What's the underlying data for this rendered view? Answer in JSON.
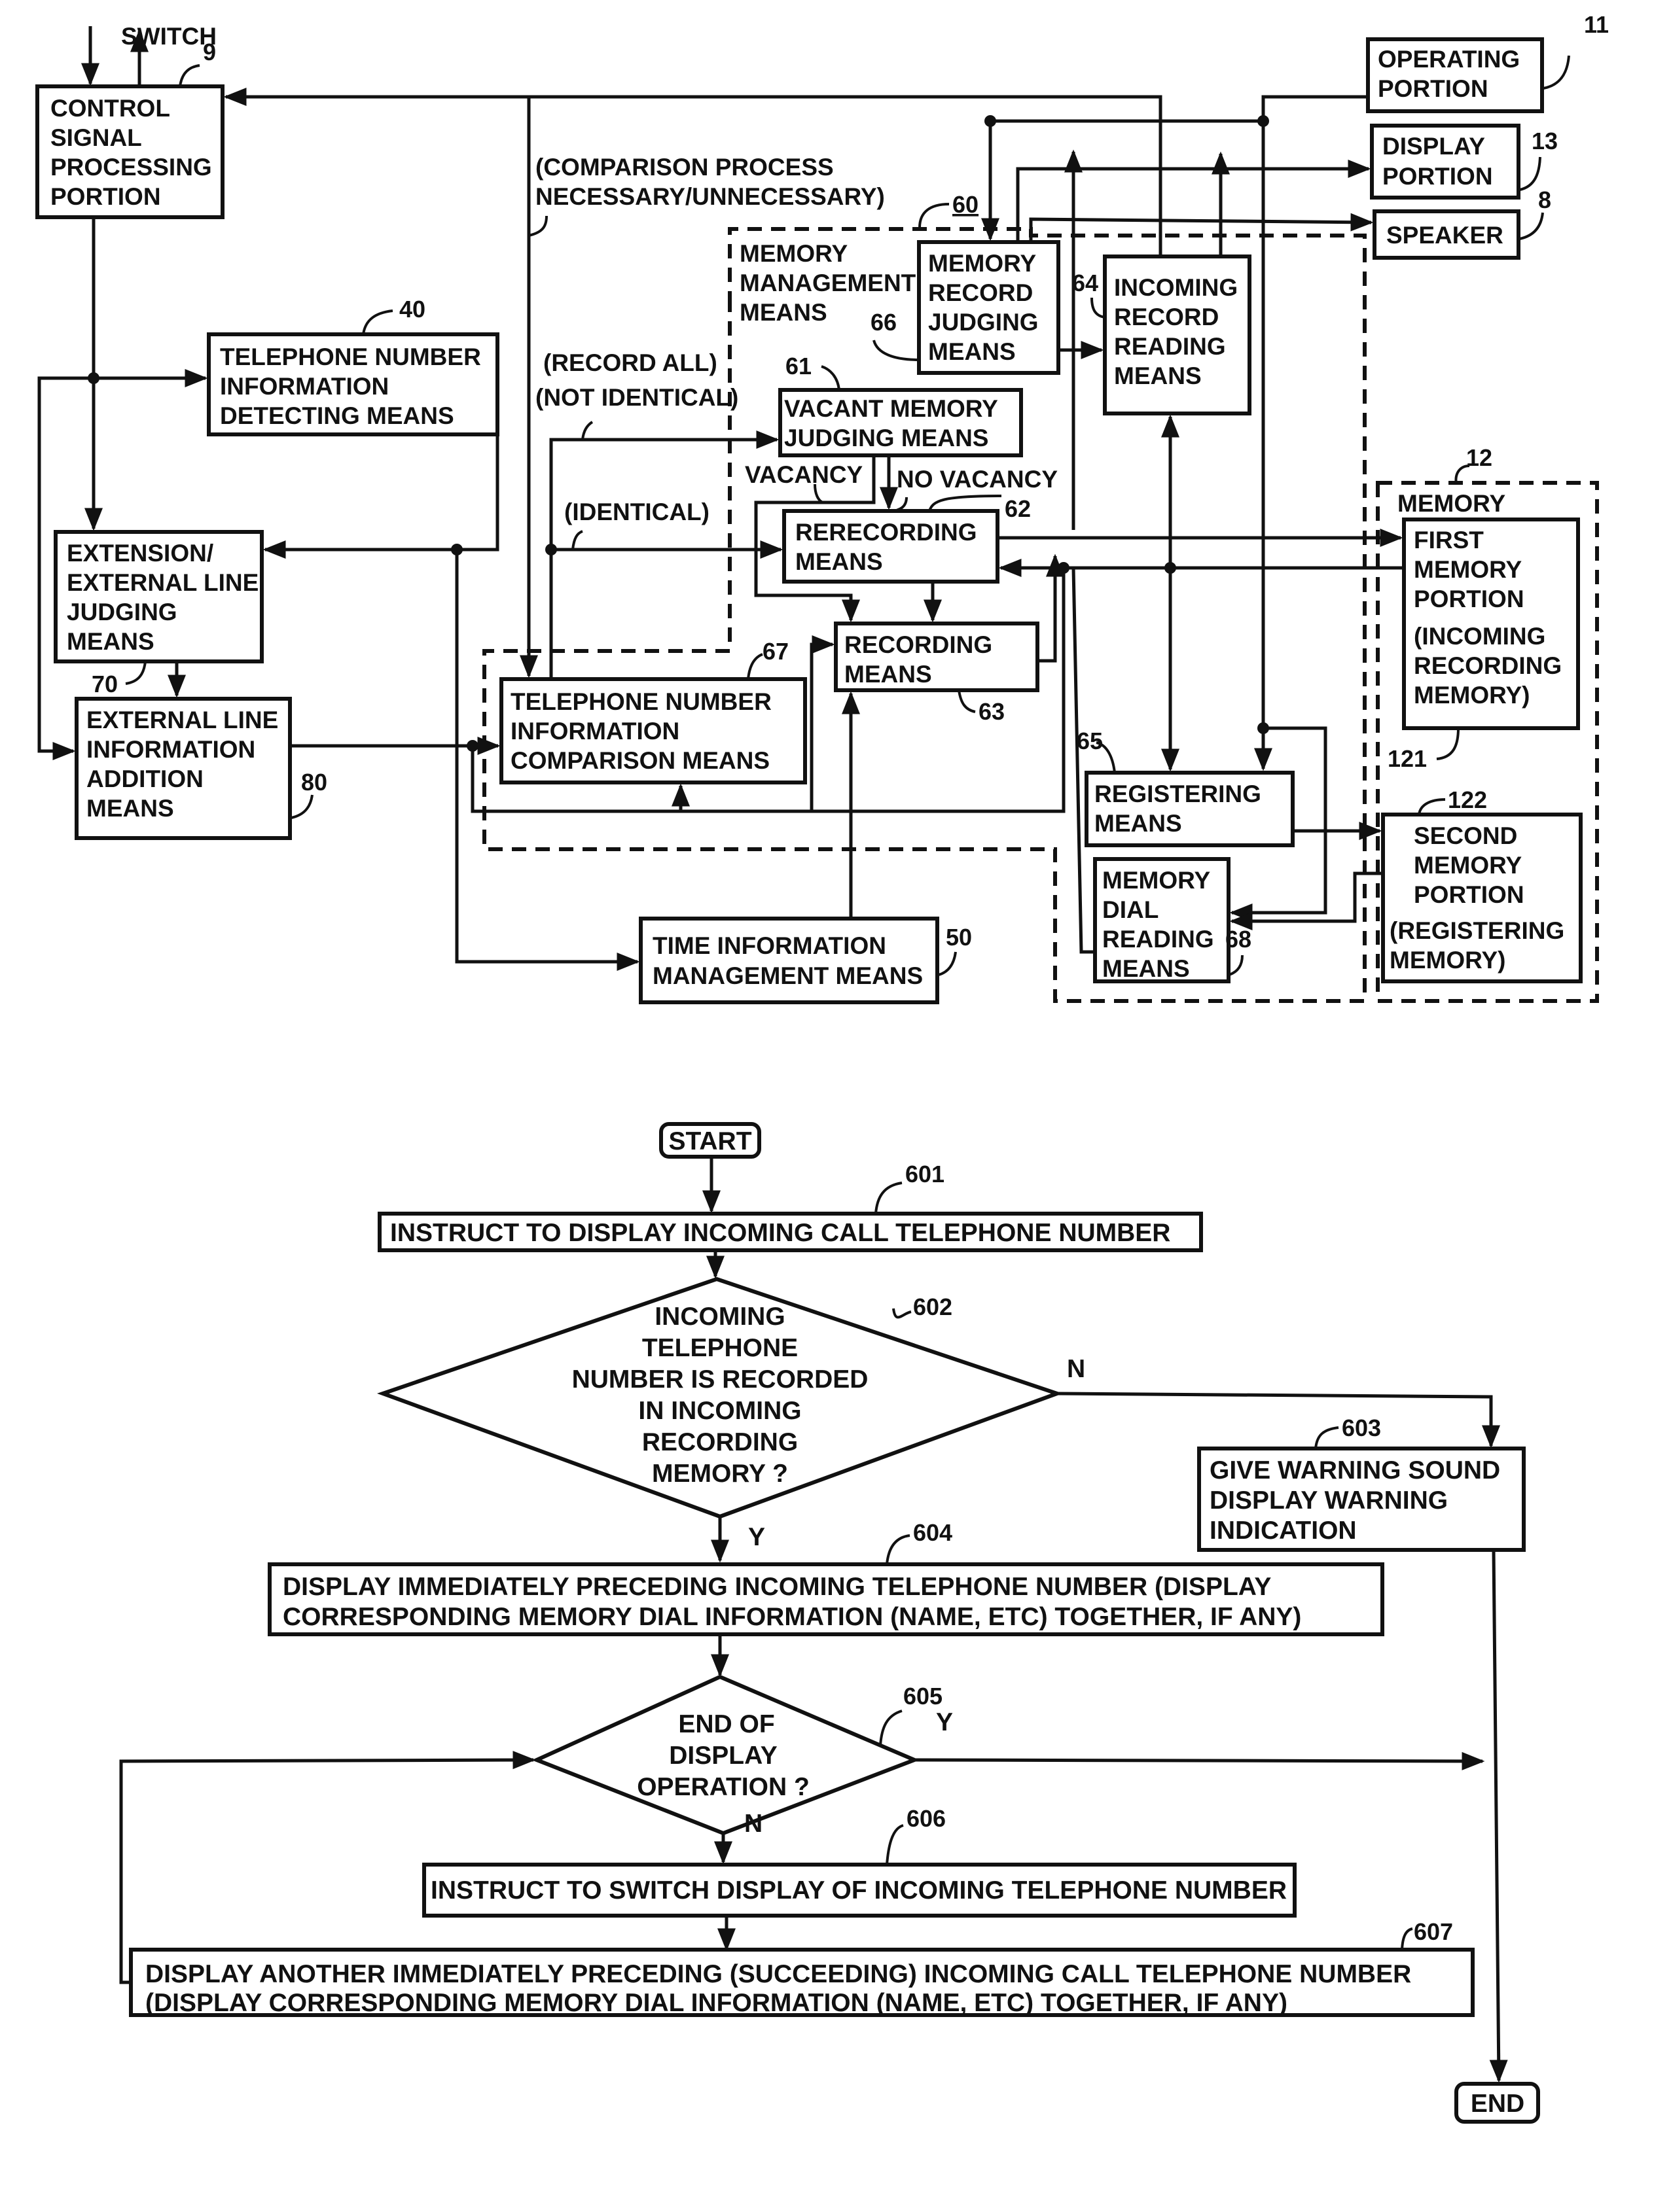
{
  "block_diagram": {
    "switch_label": "SWITCH",
    "blocks": {
      "control_signal": {
        "ref": "9",
        "lines": [
          "CONTROL",
          "SIGNAL",
          "PROCESSING",
          "PORTION"
        ]
      },
      "operating_portion": {
        "ref": "11",
        "lines": [
          "OPERATING",
          "PORTION"
        ]
      },
      "display_portion": {
        "ref": "13",
        "lines": [
          "DISPLAY",
          "PORTION"
        ]
      },
      "speaker": {
        "ref": "8",
        "lines": [
          "SPEAKER"
        ]
      },
      "tel_detect": {
        "ref": "40",
        "lines": [
          "TELEPHONE NUMBER",
          "INFORMATION",
          "DETECTING MEANS"
        ]
      },
      "memory_record_judging": {
        "ref": "66",
        "lines": [
          "MEMORY",
          "RECORD",
          "JUDGING",
          "MEANS"
        ]
      },
      "incoming_record_reading": {
        "ref": "64",
        "lines": [
          "INCOMING",
          "RECORD",
          "READING",
          "MEANS"
        ]
      },
      "vacant_memory": {
        "ref": "61",
        "lines": [
          "VACANT MEMORY",
          "JUDGING MEANS"
        ]
      },
      "rerecording": {
        "ref": "62",
        "lines": [
          "RERECORDING",
          "MEANS"
        ]
      },
      "extension_judging": {
        "ref": "70",
        "lines": [
          "EXTENSION/",
          "EXTERNAL LINE",
          "JUDGING",
          "MEANS"
        ]
      },
      "external_addition": {
        "ref": "80",
        "lines": [
          "EXTERNAL LINE",
          "INFORMATION",
          "ADDITION",
          "MEANS"
        ]
      },
      "tel_comparison": {
        "ref": "67",
        "lines": [
          "TELEPHONE NUMBER",
          "INFORMATION",
          "COMPARISON MEANS"
        ]
      },
      "recording": {
        "ref": "63",
        "lines": [
          "RECORDING",
          "MEANS"
        ]
      },
      "registering": {
        "ref": "65",
        "lines": [
          "REGISTERING",
          "MEANS"
        ]
      },
      "memory_dial_reading": {
        "ref": "68",
        "lines": [
          "MEMORY",
          "DIAL",
          "READING",
          "MEANS"
        ]
      },
      "first_memory": {
        "ref": "121",
        "lines": [
          "FIRST",
          "MEMORY",
          "PORTION",
          "(INCOMING",
          "RECORDING",
          "MEMORY)"
        ]
      },
      "second_memory": {
        "ref": "122",
        "lines": [
          "SECOND",
          "MEMORY",
          "PORTION",
          "(REGISTERING",
          "MEMORY)"
        ]
      },
      "time_info": {
        "ref": "50",
        "lines": [
          "TIME INFORMATION",
          "MANAGEMENT MEANS"
        ]
      }
    },
    "groups": {
      "memory_management": {
        "ref": "60",
        "lines": [
          "MEMORY",
          "MANAGEMENT",
          "MEANS"
        ]
      },
      "memory": {
        "ref": "12",
        "lines": [
          "MEMORY"
        ]
      }
    },
    "annotations": {
      "comparison": [
        "(COMPARISON PROCESS",
        "NECESSARY/UNNECESSARY)"
      ],
      "record_all": "(RECORD ALL)",
      "not_identical": "(NOT IDENTICAL)",
      "identical": "(IDENTICAL)",
      "vacancy": "VACANCY",
      "no_vacancy": "NO VACANCY"
    }
  },
  "flowchart": {
    "start": "START",
    "end": "END",
    "steps": [
      {
        "id": "601",
        "type": "process",
        "lines": [
          "INSTRUCT TO DISPLAY INCOMING CALL TELEPHONE NUMBER"
        ]
      },
      {
        "id": "602",
        "type": "decision",
        "lines": [
          "INCOMING",
          "TELEPHONE",
          "NUMBER IS RECORDED",
          "IN INCOMING",
          "RECORDING",
          "MEMORY ?"
        ],
        "yes": "Y",
        "no": "N"
      },
      {
        "id": "603",
        "type": "process",
        "lines": [
          "GIVE WARNING SOUND",
          "DISPLAY WARNING",
          "INDICATION"
        ]
      },
      {
        "id": "604",
        "type": "process",
        "lines": [
          "DISPLAY IMMEDIATELY PRECEDING INCOMING TELEPHONE NUMBER (DISPLAY",
          "CORRESPONDING MEMORY DIAL INFORMATION (NAME, ETC) TOGETHER, IF ANY)"
        ]
      },
      {
        "id": "605",
        "type": "decision",
        "lines": [
          "END OF",
          "DISPLAY",
          "OPERATION ?"
        ],
        "yes": "Y",
        "no": "N"
      },
      {
        "id": "606",
        "type": "process",
        "lines": [
          "INSTRUCT TO SWITCH DISPLAY OF INCOMING TELEPHONE NUMBER"
        ]
      },
      {
        "id": "607",
        "type": "process",
        "lines": [
          "DISPLAY ANOTHER IMMEDIATELY PRECEDING (SUCCEEDING) INCOMING CALL TELEPHONE NUMBER",
          "(DISPLAY CORRESPONDING MEMORY DIAL INFORMATION (NAME, ETC) TOGETHER, IF ANY)"
        ]
      }
    ]
  }
}
